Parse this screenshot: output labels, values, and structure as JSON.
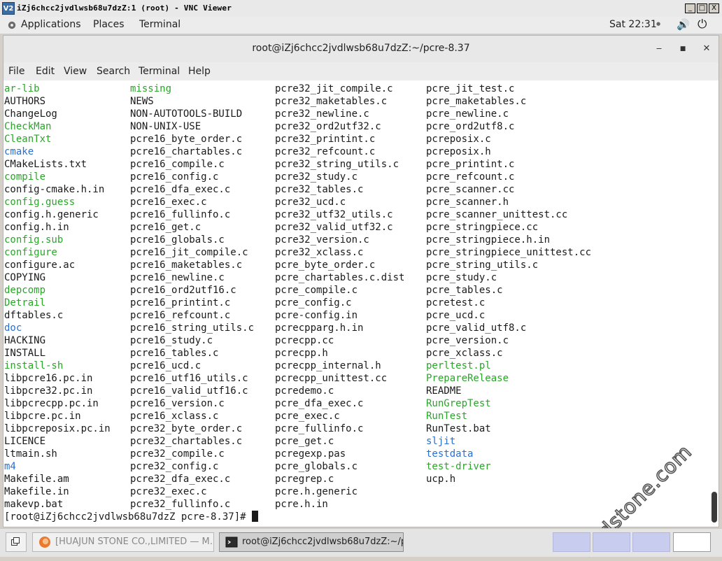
{
  "vnc": {
    "title": "iZj6chcc2jvdlwsb68u7dzZ:1 (root) - VNC Viewer",
    "logo_text": "V2",
    "ctrl_min": "_",
    "ctrl_max": "□",
    "ctrl_close": "X"
  },
  "topbar": {
    "applications": "Applications",
    "places": "Places",
    "terminal": "Terminal",
    "clock": "Sat 22:31",
    "clock_arrow": "●",
    "volume_icon": "🔊",
    "power_icon": "⏻"
  },
  "window": {
    "title": "root@iZj6chcc2jvdlwsb68u7dzZ:~/pcre-8.37",
    "min": "‒",
    "max": "■",
    "close": "✕"
  },
  "menu": {
    "file": "File",
    "edit": "Edit",
    "view": "View",
    "search": "Search",
    "terminal": "Terminal",
    "help": "Help"
  },
  "listing": {
    "col1": [
      {
        "name": "ar-lib",
        "type": "exec"
      },
      {
        "name": "AUTHORS",
        "type": "file"
      },
      {
        "name": "ChangeLog",
        "type": "file"
      },
      {
        "name": "CheckMan",
        "type": "exec"
      },
      {
        "name": "CleanTxt",
        "type": "exec"
      },
      {
        "name": "cmake",
        "type": "dir"
      },
      {
        "name": "CMakeLists.txt",
        "type": "file"
      },
      {
        "name": "compile",
        "type": "exec"
      },
      {
        "name": "config-cmake.h.in",
        "type": "file"
      },
      {
        "name": "config.guess",
        "type": "exec"
      },
      {
        "name": "config.h.generic",
        "type": "file"
      },
      {
        "name": "config.h.in",
        "type": "file"
      },
      {
        "name": "config.sub",
        "type": "exec"
      },
      {
        "name": "configure",
        "type": "exec"
      },
      {
        "name": "configure.ac",
        "type": "file"
      },
      {
        "name": "COPYING",
        "type": "file"
      },
      {
        "name": "depcomp",
        "type": "exec"
      },
      {
        "name": "Detrail",
        "type": "exec"
      },
      {
        "name": "dftables.c",
        "type": "file"
      },
      {
        "name": "doc",
        "type": "dir"
      },
      {
        "name": "HACKING",
        "type": "file"
      },
      {
        "name": "INSTALL",
        "type": "file"
      },
      {
        "name": "install-sh",
        "type": "exec"
      },
      {
        "name": "libpcre16.pc.in",
        "type": "file"
      },
      {
        "name": "libpcre32.pc.in",
        "type": "file"
      },
      {
        "name": "libpcrecpp.pc.in",
        "type": "file"
      },
      {
        "name": "libpcre.pc.in",
        "type": "file"
      },
      {
        "name": "libpcreposix.pc.in",
        "type": "file"
      },
      {
        "name": "LICENCE",
        "type": "file"
      },
      {
        "name": "ltmain.sh",
        "type": "file"
      },
      {
        "name": "m4",
        "type": "dir"
      },
      {
        "name": "Makefile.am",
        "type": "file"
      },
      {
        "name": "Makefile.in",
        "type": "file"
      },
      {
        "name": "makevp.bat",
        "type": "file"
      }
    ],
    "col2": [
      {
        "name": "missing",
        "type": "exec"
      },
      {
        "name": "NEWS",
        "type": "file"
      },
      {
        "name": "NON-AUTOTOOLS-BUILD",
        "type": "file"
      },
      {
        "name": "NON-UNIX-USE",
        "type": "file"
      },
      {
        "name": "pcre16_byte_order.c",
        "type": "file"
      },
      {
        "name": "pcre16_chartables.c",
        "type": "file"
      },
      {
        "name": "pcre16_compile.c",
        "type": "file"
      },
      {
        "name": "pcre16_config.c",
        "type": "file"
      },
      {
        "name": "pcre16_dfa_exec.c",
        "type": "file"
      },
      {
        "name": "pcre16_exec.c",
        "type": "file"
      },
      {
        "name": "pcre16_fullinfo.c",
        "type": "file"
      },
      {
        "name": "pcre16_get.c",
        "type": "file"
      },
      {
        "name": "pcre16_globals.c",
        "type": "file"
      },
      {
        "name": "pcre16_jit_compile.c",
        "type": "file"
      },
      {
        "name": "pcre16_maketables.c",
        "type": "file"
      },
      {
        "name": "pcre16_newline.c",
        "type": "file"
      },
      {
        "name": "pcre16_ord2utf16.c",
        "type": "file"
      },
      {
        "name": "pcre16_printint.c",
        "type": "file"
      },
      {
        "name": "pcre16_refcount.c",
        "type": "file"
      },
      {
        "name": "pcre16_string_utils.c",
        "type": "file"
      },
      {
        "name": "pcre16_study.c",
        "type": "file"
      },
      {
        "name": "pcre16_tables.c",
        "type": "file"
      },
      {
        "name": "pcre16_ucd.c",
        "type": "file"
      },
      {
        "name": "pcre16_utf16_utils.c",
        "type": "file"
      },
      {
        "name": "pcre16_valid_utf16.c",
        "type": "file"
      },
      {
        "name": "pcre16_version.c",
        "type": "file"
      },
      {
        "name": "pcre16_xclass.c",
        "type": "file"
      },
      {
        "name": "pcre32_byte_order.c",
        "type": "file"
      },
      {
        "name": "pcre32_chartables.c",
        "type": "file"
      },
      {
        "name": "pcre32_compile.c",
        "type": "file"
      },
      {
        "name": "pcre32_config.c",
        "type": "file"
      },
      {
        "name": "pcre32_dfa_exec.c",
        "type": "file"
      },
      {
        "name": "pcre32_exec.c",
        "type": "file"
      },
      {
        "name": "pcre32_fullinfo.c",
        "type": "file"
      }
    ],
    "col3": [
      {
        "name": "pcre32_jit_compile.c",
        "type": "file"
      },
      {
        "name": "pcre32_maketables.c",
        "type": "file"
      },
      {
        "name": "pcre32_newline.c",
        "type": "file"
      },
      {
        "name": "pcre32_ord2utf32.c",
        "type": "file"
      },
      {
        "name": "pcre32_printint.c",
        "type": "file"
      },
      {
        "name": "pcre32_refcount.c",
        "type": "file"
      },
      {
        "name": "pcre32_string_utils.c",
        "type": "file"
      },
      {
        "name": "pcre32_study.c",
        "type": "file"
      },
      {
        "name": "pcre32_tables.c",
        "type": "file"
      },
      {
        "name": "pcre32_ucd.c",
        "type": "file"
      },
      {
        "name": "pcre32_utf32_utils.c",
        "type": "file"
      },
      {
        "name": "pcre32_valid_utf32.c",
        "type": "file"
      },
      {
        "name": "pcre32_version.c",
        "type": "file"
      },
      {
        "name": "pcre32_xclass.c",
        "type": "file"
      },
      {
        "name": "pcre_byte_order.c",
        "type": "file"
      },
      {
        "name": "pcre_chartables.c.dist",
        "type": "file"
      },
      {
        "name": "pcre_compile.c",
        "type": "file"
      },
      {
        "name": "pcre_config.c",
        "type": "file"
      },
      {
        "name": "pcre-config.in",
        "type": "file"
      },
      {
        "name": "pcrecpparg.h.in",
        "type": "file"
      },
      {
        "name": "pcrecpp.cc",
        "type": "file"
      },
      {
        "name": "pcrecpp.h",
        "type": "file"
      },
      {
        "name": "pcrecpp_internal.h",
        "type": "file"
      },
      {
        "name": "pcrecpp_unittest.cc",
        "type": "file"
      },
      {
        "name": "pcredemo.c",
        "type": "file"
      },
      {
        "name": "pcre_dfa_exec.c",
        "type": "file"
      },
      {
        "name": "pcre_exec.c",
        "type": "file"
      },
      {
        "name": "pcre_fullinfo.c",
        "type": "file"
      },
      {
        "name": "pcre_get.c",
        "type": "file"
      },
      {
        "name": "pcregexp.pas",
        "type": "file"
      },
      {
        "name": "pcre_globals.c",
        "type": "file"
      },
      {
        "name": "pcregrep.c",
        "type": "file"
      },
      {
        "name": "pcre.h.generic",
        "type": "file"
      },
      {
        "name": "pcre.h.in",
        "type": "file"
      }
    ],
    "col4": [
      {
        "name": "pcre_jit_test.c",
        "type": "file"
      },
      {
        "name": "pcre_maketables.c",
        "type": "file"
      },
      {
        "name": "pcre_newline.c",
        "type": "file"
      },
      {
        "name": "pcre_ord2utf8.c",
        "type": "file"
      },
      {
        "name": "pcreposix.c",
        "type": "file"
      },
      {
        "name": "pcreposix.h",
        "type": "file"
      },
      {
        "name": "pcre_printint.c",
        "type": "file"
      },
      {
        "name": "pcre_refcount.c",
        "type": "file"
      },
      {
        "name": "pcre_scanner.cc",
        "type": "file"
      },
      {
        "name": "pcre_scanner.h",
        "type": "file"
      },
      {
        "name": "pcre_scanner_unittest.cc",
        "type": "file"
      },
      {
        "name": "pcre_stringpiece.cc",
        "type": "file"
      },
      {
        "name": "pcre_stringpiece.h.in",
        "type": "file"
      },
      {
        "name": "pcre_stringpiece_unittest.cc",
        "type": "file"
      },
      {
        "name": "pcre_string_utils.c",
        "type": "file"
      },
      {
        "name": "pcre_study.c",
        "type": "file"
      },
      {
        "name": "pcre_tables.c",
        "type": "file"
      },
      {
        "name": "pcretest.c",
        "type": "file"
      },
      {
        "name": "pcre_ucd.c",
        "type": "file"
      },
      {
        "name": "pcre_valid_utf8.c",
        "type": "file"
      },
      {
        "name": "pcre_version.c",
        "type": "file"
      },
      {
        "name": "pcre_xclass.c",
        "type": "file"
      },
      {
        "name": "perltest.pl",
        "type": "exec"
      },
      {
        "name": "PrepareRelease",
        "type": "exec"
      },
      {
        "name": "README",
        "type": "file"
      },
      {
        "name": "RunGrepTest",
        "type": "exec"
      },
      {
        "name": "RunTest",
        "type": "exec"
      },
      {
        "name": "RunTest.bat",
        "type": "file"
      },
      {
        "name": "sljit",
        "type": "dir"
      },
      {
        "name": "testdata",
        "type": "dir"
      },
      {
        "name": "test-driver",
        "type": "exec"
      },
      {
        "name": "ucp.h",
        "type": "file"
      }
    ]
  },
  "prompt": "[root@iZj6chcc2jvdlwsb68u7dzZ pcre-8.37]# ",
  "watermark": "bndstone.com",
  "taskbar": {
    "firefox_task": "[HUAJUN STONE CO.,LIMITED — M…",
    "terminal_task": "root@iZj6chcc2jvdlwsb68u7dzZ:~/p…"
  },
  "colors": {
    "exec": "#2aa52a",
    "dir": "#2a6fd1",
    "text": "#1a1a1a",
    "workspace": "#c8cdf0"
  }
}
